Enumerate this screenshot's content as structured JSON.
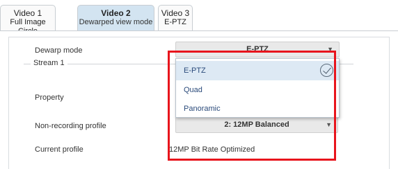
{
  "tabs": [
    {
      "title": "Video 1",
      "subtitle": "Full Image Circle",
      "active": false
    },
    {
      "title": "Video 2",
      "subtitle": "Dewarped view mode",
      "active": true
    },
    {
      "title": "Video 3",
      "subtitle": "E-PTZ",
      "active": false
    }
  ],
  "form": {
    "dewarp_mode_label": "Dewarp mode",
    "dewarp_mode_value": "E-PTZ",
    "stream_legend": "Stream 1",
    "property_label": "Property",
    "nonrecording_label": "Non-recording profile",
    "nonrecording_value": "2: 12MP Balanced",
    "current_profile_label": "Current profile",
    "current_profile_value": "12MP Bit Rate Optimized"
  },
  "dropdown": {
    "options": [
      "E-PTZ",
      "Quad",
      "Panoramic"
    ],
    "selected": "E-PTZ"
  },
  "colors": {
    "highlight": "#e8141c",
    "active_tab": "#d3e4f1",
    "selected_option": "#dde9f4"
  },
  "icons": {
    "select_arrow": "chevron-down-icon",
    "selected_check": "check-circle-icon"
  }
}
